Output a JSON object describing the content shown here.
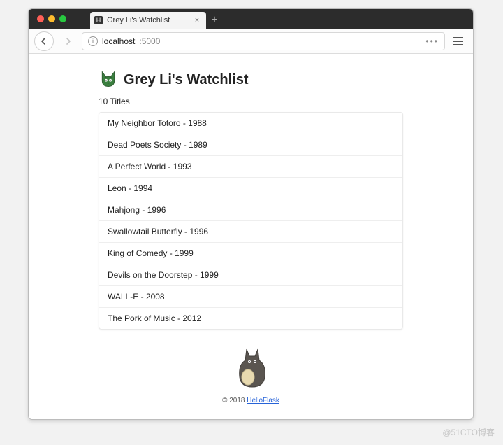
{
  "browser": {
    "tab_title": "Grey Li's Watchlist",
    "url_host": "localhost",
    "url_port": ":5000",
    "more_label": "•••"
  },
  "page": {
    "title": "Grey Li's Watchlist",
    "count_label": "10 Titles",
    "movies": [
      {
        "title": "My Neighbor Totoro",
        "year": "1988"
      },
      {
        "title": "Dead Poets Society",
        "year": "1989"
      },
      {
        "title": "A Perfect World",
        "year": "1993"
      },
      {
        "title": "Leon",
        "year": "1994"
      },
      {
        "title": "Mahjong",
        "year": "1996"
      },
      {
        "title": "Swallowtail Butterfly",
        "year": "1996"
      },
      {
        "title": "King of Comedy",
        "year": "1999"
      },
      {
        "title": "Devils on the Doorstep",
        "year": "1999"
      },
      {
        "title": "WALL-E",
        "year": "2008"
      },
      {
        "title": "The Pork of Music",
        "year": "2012"
      }
    ],
    "footer_prefix": "© 2018 ",
    "footer_link_label": "HelloFlask"
  },
  "watermark": "@51CTO博客"
}
